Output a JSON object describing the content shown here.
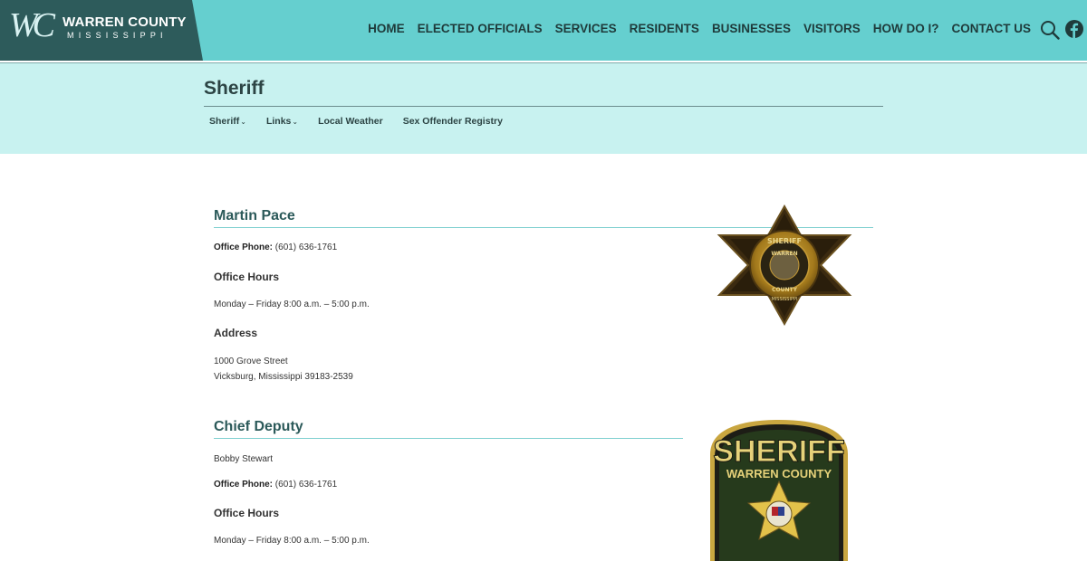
{
  "header": {
    "logo_mark": "WC",
    "logo_title": "WARREN COUNTY",
    "logo_subtitle": "MISSISSIPPI",
    "nav": [
      "HOME",
      "ELECTED OFFICIALS",
      "SERVICES",
      "RESIDENTS",
      "BUSINESSES",
      "VISITORS",
      "HOW DO I?",
      "CONTACT US"
    ],
    "icons": {
      "search": "search-icon",
      "social": "facebook-icon"
    },
    "bg_color": "#65cfcf",
    "logo_bg_color": "#2d5b5b"
  },
  "page": {
    "title": "Sheriff",
    "subnav": [
      {
        "label": "Sheriff",
        "has_dropdown": true
      },
      {
        "label": "Links",
        "has_dropdown": true
      },
      {
        "label": "Local Weather",
        "has_dropdown": false
      },
      {
        "label": "Sex Offender Registry",
        "has_dropdown": false
      }
    ],
    "band_color": "#c8f2f0"
  },
  "sheriff": {
    "heading": "Martin Pace",
    "phone_label": "Office Phone:",
    "phone": "(601) 636-1761",
    "hours_heading": "Office Hours",
    "hours": "Monday – Friday 8:00 a.m. – 5:00 p.m.",
    "address_heading": "Address",
    "address_line1": "1000 Grove Street",
    "address_line2": "Vicksburg, Mississippi 39183-2539"
  },
  "badge": {
    "top_text": "SHERIFF",
    "middle_text": "WARREN",
    "lower_text": "COUNTY",
    "bottom_text": "MISSISSIPPI"
  },
  "chief_deputy": {
    "heading": "Chief Deputy",
    "name": "Bobby Stewart",
    "phone_label": "Office Phone:",
    "phone": "(601) 636-1761",
    "hours_heading": "Office Hours",
    "hours": "Monday – Friday 8:00 a.m. – 5:00 p.m."
  },
  "patch": {
    "top_text": "SHERIFF",
    "arc_text": "WARREN COUNTY"
  }
}
